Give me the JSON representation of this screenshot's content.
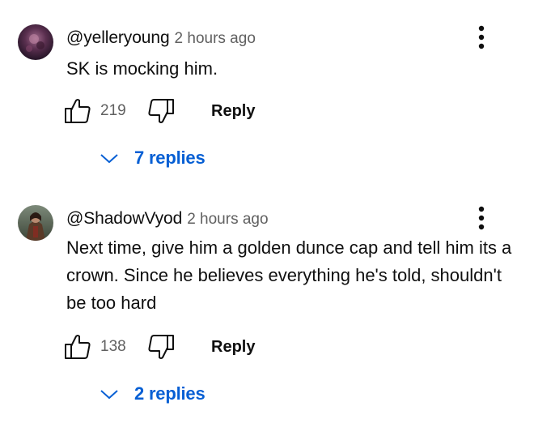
{
  "comments": [
    {
      "handle": "@yelleryoung",
      "time": "2 hours ago",
      "body": "SK is mocking him.",
      "likes": "219",
      "reply_label": "Reply",
      "replies_label": "7 replies"
    },
    {
      "handle": "@ShadowVyod",
      "time": "2 hours ago",
      "body": "Next time, give him a golden dunce cap and tell him its a crown. Since he believes everything he's told, shouldn't be too hard",
      "likes": "138",
      "reply_label": "Reply",
      "replies_label": "2 replies"
    }
  ],
  "colors": {
    "link_blue": "#065fd4",
    "meta_gray": "#606060",
    "text": "#0f0f0f"
  },
  "icons": {
    "like": "thumbs-up-icon",
    "dislike": "thumbs-down-icon",
    "menu": "more-vert-icon",
    "expand": "chevron-down-icon"
  }
}
